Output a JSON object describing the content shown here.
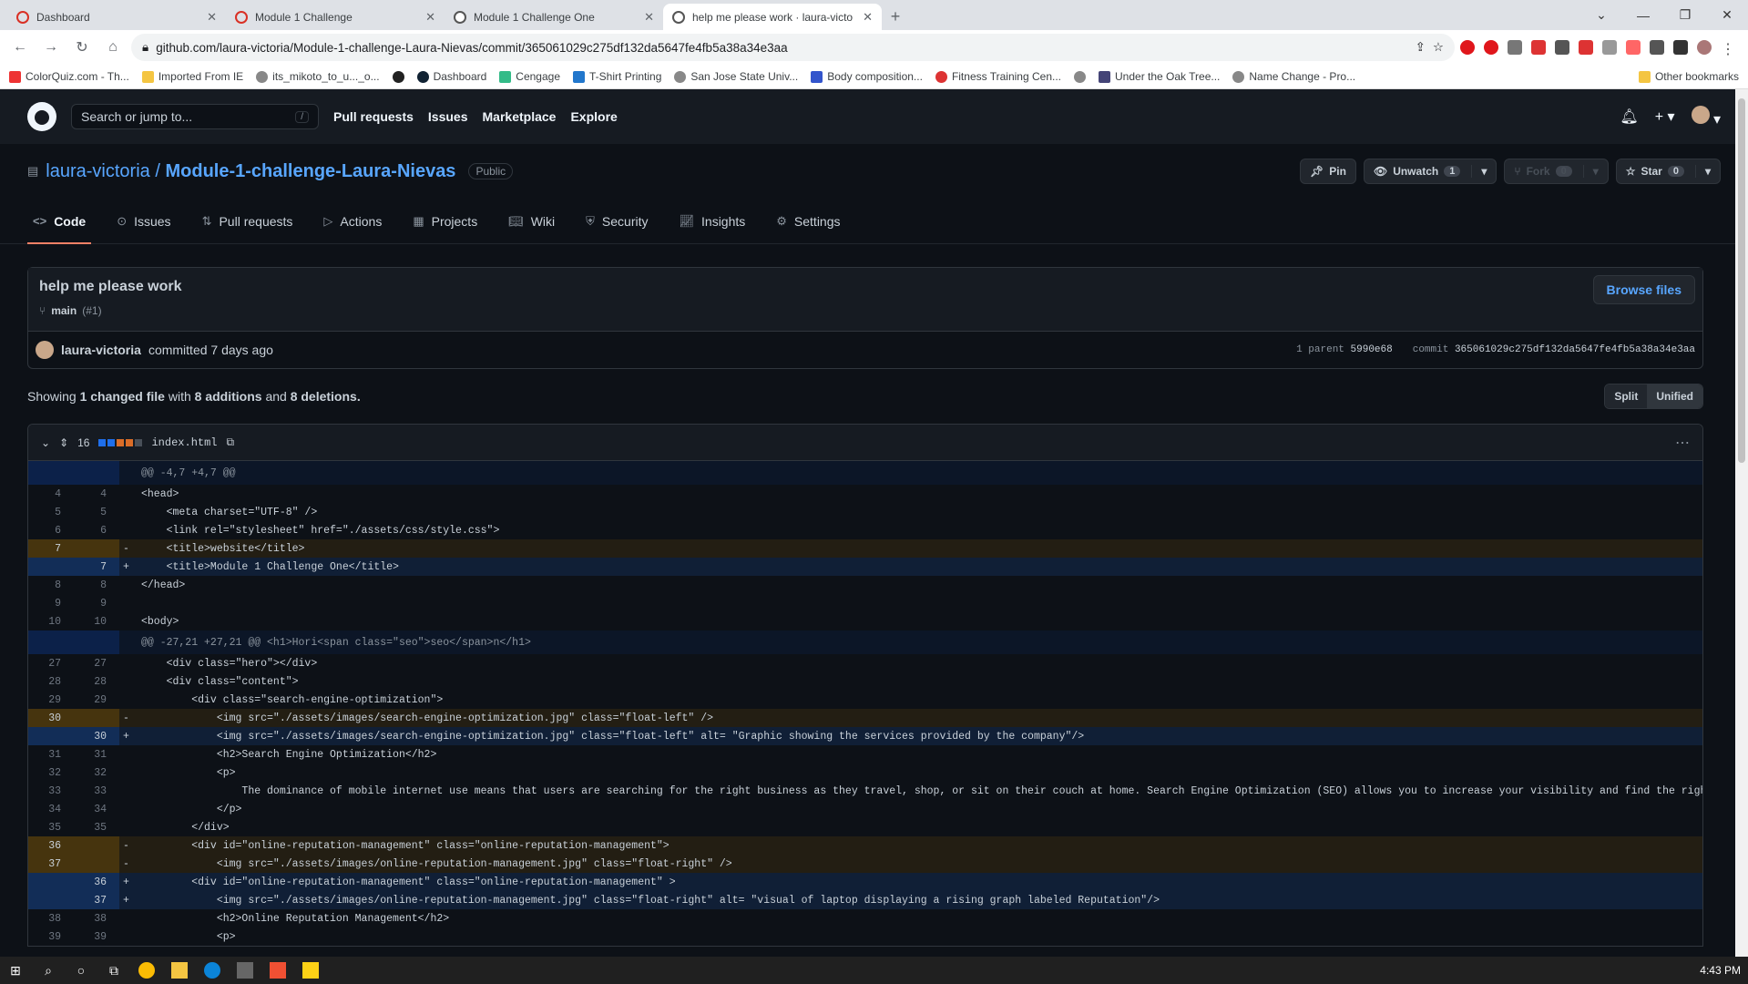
{
  "browser": {
    "tabs": [
      {
        "title": "Dashboard",
        "active": false
      },
      {
        "title": "Module 1 Challenge",
        "active": false
      },
      {
        "title": "Module 1 Challenge One",
        "active": false
      },
      {
        "title": "help me please work · laura-victo",
        "active": true
      }
    ],
    "url": "github.com/laura-victoria/Module-1-challenge-Laura-Nievas/commit/365061029c275df132da5647fe4fb5a38a34e3aa",
    "bookmarks": [
      "ColorQuiz.com - Th...",
      "Imported From IE",
      "its_mikoto_to_u..._o...",
      "Dashboard",
      "Cengage",
      "T-Shirt Printing",
      "San Jose State Univ...",
      "Body composition...",
      "Fitness Training Cen...",
      "Under the Oak Tree...",
      "Name Change - Pro..."
    ],
    "other_bookmarks": "Other bookmarks"
  },
  "gh": {
    "search_placeholder": "Search or jump to...",
    "search_key": "/",
    "nav": [
      "Pull requests",
      "Issues",
      "Marketplace",
      "Explore"
    ]
  },
  "repo": {
    "owner": "laura-victoria",
    "name": "Module-1-challenge-Laura-Nievas",
    "visibility": "Public",
    "pin": "Pin",
    "unwatch": "Unwatch",
    "unwatch_count": "1",
    "fork": "Fork",
    "fork_count": "0",
    "star": "Star",
    "star_count": "0",
    "tabs": [
      "Code",
      "Issues",
      "Pull requests",
      "Actions",
      "Projects",
      "Wiki",
      "Security",
      "Insights",
      "Settings"
    ]
  },
  "commit": {
    "title": "help me please work",
    "branch": "main",
    "pr": "(#1)",
    "browse": "Browse files",
    "author": "laura-victoria",
    "committed": "committed 7 days ago",
    "parent_label": "1 parent",
    "parent": "5990e68",
    "commit_label": "commit",
    "sha": "365061029c275df132da5647fe4fb5a38a34e3aa"
  },
  "summary": {
    "showing": "Showing",
    "changed": "1 changed file",
    "with": "with",
    "additions": "8 additions",
    "and": "and",
    "deletions": "8 deletions.",
    "split": "Split",
    "unified": "Unified"
  },
  "file": {
    "changes": "16",
    "name": "index.html"
  },
  "diff": [
    {
      "t": "hunk",
      "o": "",
      "n": "",
      "s": "",
      "c": "@@ -4,7 +4,7 @@"
    },
    {
      "t": "ctx",
      "o": "4",
      "n": "4",
      "s": "",
      "c": "<head>"
    },
    {
      "t": "ctx",
      "o": "5",
      "n": "5",
      "s": "",
      "c": "    <meta charset=\"UTF-8\" />"
    },
    {
      "t": "ctx",
      "o": "6",
      "n": "6",
      "s": "",
      "c": "    <link rel=\"stylesheet\" href=\"./assets/css/style.css\">"
    },
    {
      "t": "orangedel",
      "o": "7",
      "n": "",
      "s": "-",
      "c": "    <title>website</title>"
    },
    {
      "t": "blueadd",
      "o": "",
      "n": "7",
      "s": "+",
      "c": "    <title>Module 1 Challenge One</title>"
    },
    {
      "t": "ctx",
      "o": "8",
      "n": "8",
      "s": "",
      "c": "</head>"
    },
    {
      "t": "ctx",
      "o": "9",
      "n": "9",
      "s": "",
      "c": ""
    },
    {
      "t": "ctx",
      "o": "10",
      "n": "10",
      "s": "",
      "c": "<body>"
    },
    {
      "t": "hunk",
      "o": "",
      "n": "",
      "s": "",
      "c": "@@ -27,21 +27,21 @@ <h1>Hori<span class=\"seo\">seo</span>n</h1>"
    },
    {
      "t": "ctx",
      "o": "27",
      "n": "27",
      "s": "",
      "c": "    <div class=\"hero\"></div>"
    },
    {
      "t": "ctx",
      "o": "28",
      "n": "28",
      "s": "",
      "c": "    <div class=\"content\">"
    },
    {
      "t": "ctx",
      "o": "29",
      "n": "29",
      "s": "",
      "c": "        <div class=\"search-engine-optimization\">"
    },
    {
      "t": "orangedel",
      "o": "30",
      "n": "",
      "s": "-",
      "c": "            <img src=\"./assets/images/search-engine-optimization.jpg\" class=\"float-left\" />"
    },
    {
      "t": "blueadd",
      "o": "",
      "n": "30",
      "s": "+",
      "c": "            <img src=\"./assets/images/search-engine-optimization.jpg\" class=\"float-left\" alt= \"Graphic showing the services provided by the company\"/>"
    },
    {
      "t": "ctx",
      "o": "31",
      "n": "31",
      "s": "",
      "c": "            <h2>Search Engine Optimization</h2>"
    },
    {
      "t": "ctx",
      "o": "32",
      "n": "32",
      "s": "",
      "c": "            <p>"
    },
    {
      "t": "ctx",
      "o": "33",
      "n": "33",
      "s": "",
      "c": "                The dominance of mobile internet use means that users are searching for the right business as they travel, shop, or sit on their couch at home. Search Engine Optimization (SEO) allows you to increase your visibility and find the right customers"
    },
    {
      "t": "ctx",
      "o": "34",
      "n": "34",
      "s": "",
      "c": "            </p>"
    },
    {
      "t": "ctx",
      "o": "35",
      "n": "35",
      "s": "",
      "c": "        </div>"
    },
    {
      "t": "orangedel",
      "o": "36",
      "n": "",
      "s": "-",
      "c": "        <div id=\"online-reputation-management\" class=\"online-reputation-management\">"
    },
    {
      "t": "orangedel",
      "o": "37",
      "n": "",
      "s": "-",
      "c": "            <img src=\"./assets/images/online-reputation-management.jpg\" class=\"float-right\" />"
    },
    {
      "t": "blueadd",
      "o": "",
      "n": "36",
      "s": "+",
      "c": "        <div id=\"online-reputation-management\" class=\"online-reputation-management\" >"
    },
    {
      "t": "blueadd",
      "o": "",
      "n": "37",
      "s": "+",
      "c": "            <img src=\"./assets/images/online-reputation-management.jpg\" class=\"float-right\" alt= \"visual of laptop displaying a rising graph labeled Reputation\"/>"
    },
    {
      "t": "ctx",
      "o": "38",
      "n": "38",
      "s": "",
      "c": "            <h2>Online Reputation Management</h2>"
    },
    {
      "t": "ctx",
      "o": "39",
      "n": "39",
      "s": "",
      "c": "            <p>"
    }
  ],
  "taskbar": {
    "time": "4:43 PM"
  },
  "colors": {
    "accent": "#58a6ff",
    "underline": "#f78166",
    "bg": "#0d1117"
  }
}
